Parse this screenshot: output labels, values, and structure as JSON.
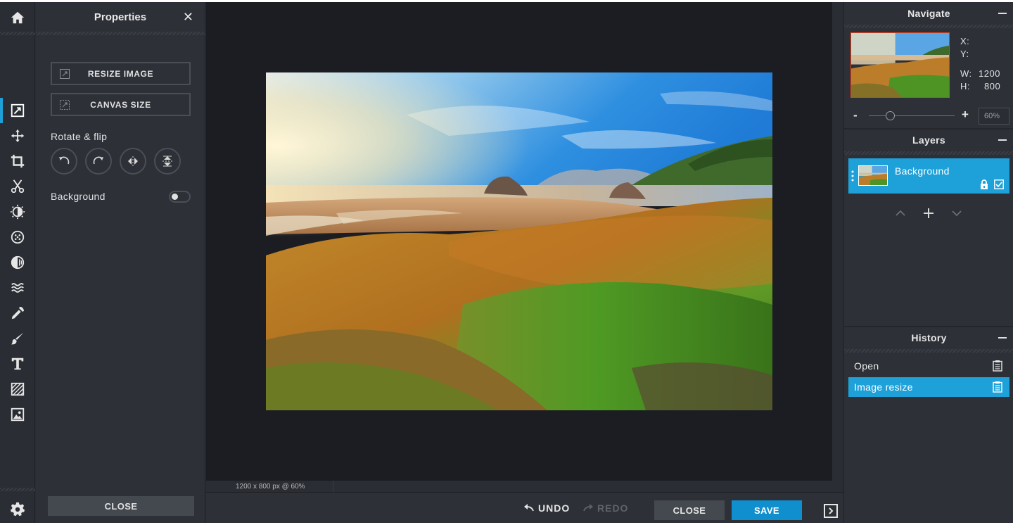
{
  "app": {
    "toolbar": {
      "tools": [
        "home-icon",
        "resize-icon",
        "move-icon",
        "crop-icon",
        "cut-icon",
        "adjust-icon",
        "effects-icon",
        "filters-icon",
        "liquify-icon",
        "picker-icon",
        "brush-icon",
        "text-icon",
        "pattern-icon",
        "image-icon",
        "settings-icon"
      ],
      "active_tool": "resize-icon"
    },
    "properties": {
      "title": "Properties",
      "resize_label": "RESIZE IMAGE",
      "canvas_label": "CANVAS SIZE",
      "rotate_label": "Rotate & flip",
      "background_label": "Background",
      "background_toggle": false,
      "close_label": "CLOSE"
    },
    "canvas": {
      "status_text": "1200 x 800 px @ 60%"
    },
    "bottombar": {
      "undo_label": "UNDO",
      "redo_label": "REDO",
      "close_label": "CLOSE",
      "save_label": "SAVE"
    },
    "navigate": {
      "title": "Navigate",
      "x_label": "X:",
      "y_label": "Y:",
      "w_label": "W:",
      "h_label": "H:",
      "w_value": "1200",
      "h_value": "800",
      "zoom_minus": "-",
      "zoom_plus": "+",
      "zoom_value": "60%",
      "zoom_level": 0.25
    },
    "layers": {
      "title": "Layers",
      "items": [
        {
          "name": "Background",
          "locked": true,
          "visible": true
        }
      ]
    },
    "history": {
      "title": "History",
      "items": [
        {
          "label": "Open",
          "selected": false
        },
        {
          "label": "Image resize",
          "selected": true
        }
      ]
    },
    "colors": {
      "accent": "#1ea1d9",
      "save_button": "#0f8fce",
      "panel_bg": "#2d3037",
      "stage_bg": "#1c1d22"
    }
  }
}
